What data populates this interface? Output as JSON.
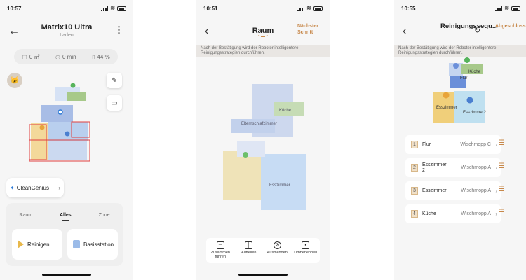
{
  "screen1": {
    "time": "10:57",
    "title": "Matrix10 Ultra",
    "subtitle": "Laden",
    "stats": [
      {
        "icon": "area-icon",
        "value": "0 ㎡"
      },
      {
        "icon": "clock-icon",
        "value": "0 min"
      },
      {
        "icon": "battery-icon",
        "value": "44 %"
      }
    ],
    "clean_genius": "CleanGenius",
    "modes": [
      "Raum",
      "Alles",
      "Zone"
    ],
    "active_mode": "Alles",
    "start_button": "Reinigen",
    "station_button": "Basisstation"
  },
  "screen2": {
    "time": "10:51",
    "title": "Raum",
    "next": "Nächster Schritt",
    "info": "Nach der Bestätigung wird der Roboter intelligentere Reinigungsstrategien durchführen.",
    "rooms": [
      "Küche",
      "Elternschlafzimmer",
      "Esszimmer"
    ],
    "tools": [
      {
        "icon": "merge-icon",
        "label": "Zusammen führen"
      },
      {
        "icon": "split-icon",
        "label": "Aufteilen"
      },
      {
        "icon": "hide-icon",
        "label": "Ausblenden"
      },
      {
        "icon": "rename-icon",
        "label": "Umbenennen"
      }
    ]
  },
  "screen3": {
    "time": "10:55",
    "title": "Reinigungssequ...",
    "done": "Abgeschlossen",
    "info": "Nach der Bestätigung wird der Roboter intelligentere Reinigungsstrategien durchführen.",
    "map_labels": [
      "Küche",
      "Flur",
      "Esszimmer",
      "Esszimmer2"
    ],
    "sequence": [
      {
        "num": "1",
        "name": "Flur",
        "mode": "Wischmopp C"
      },
      {
        "num": "2",
        "name": "Esszimmer 2",
        "mode": "Wischmopp A"
      },
      {
        "num": "3",
        "name": "Esszimmer",
        "mode": "Wischmopp A"
      },
      {
        "num": "4",
        "name": "Küche",
        "mode": "Wischmopp A"
      }
    ]
  }
}
